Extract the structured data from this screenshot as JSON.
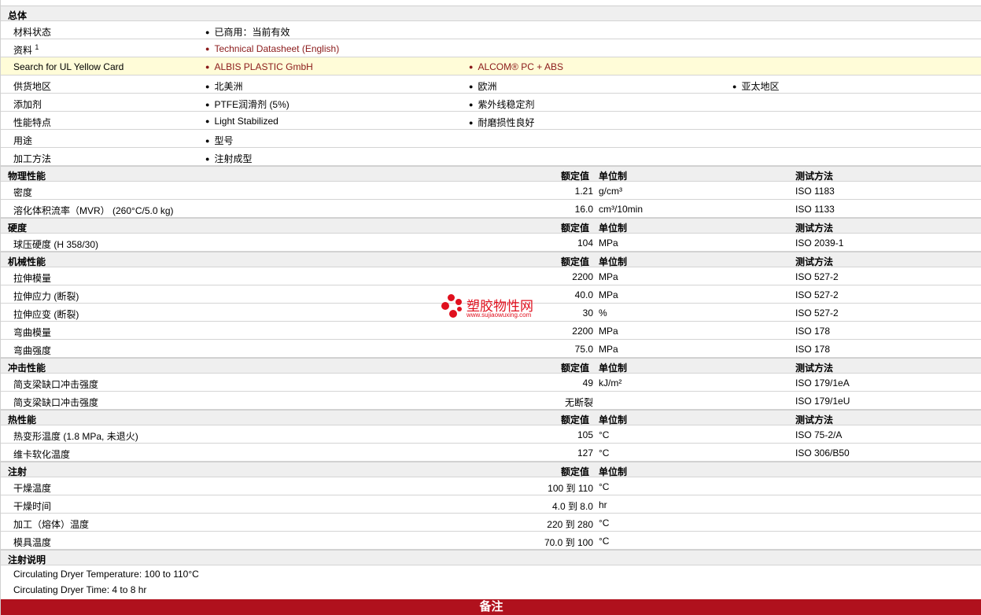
{
  "general": {
    "title": "总体",
    "rows": [
      {
        "label": "材料状态",
        "items": [
          "已商用：当前有效"
        ]
      },
      {
        "label": "资料",
        "sup": "1",
        "items": [
          "Technical Datasheet (English)"
        ],
        "links": true
      },
      {
        "label": "Search for UL Yellow Card",
        "items": [
          "ALBIS PLASTIC GmbH",
          "ALCOM® PC + ABS"
        ],
        "links": true,
        "highlight": true
      },
      {
        "label": "供货地区",
        "items": [
          "北美洲",
          "欧洲",
          "亚太地区"
        ]
      },
      {
        "label": "添加剂",
        "items": [
          "PTFE润滑剂 (5%)",
          "紫外线稳定剂"
        ]
      },
      {
        "label": "性能特点",
        "items": [
          "Light Stabilized",
          "耐磨损性良好"
        ]
      },
      {
        "label": "用途",
        "items": [
          "型号"
        ]
      },
      {
        "label": "加工方法",
        "items": [
          "注射成型"
        ]
      }
    ]
  },
  "headers": {
    "rated": "额定值",
    "unit": "单位制",
    "method": "测试方法"
  },
  "sections": [
    {
      "title": "物理性能",
      "show_method": true,
      "rows": [
        {
          "label": "密度",
          "value": "1.21",
          "unit": "g/cm³",
          "method": "ISO 1183"
        },
        {
          "label": "溶化体积流率（MVR） (260°C/5.0 kg)",
          "value": "16.0",
          "unit": "cm³/10min",
          "method": "ISO 1133"
        }
      ]
    },
    {
      "title": "硬度",
      "show_method": true,
      "rows": [
        {
          "label": "球压硬度 (H 358/30)",
          "value": "104",
          "unit": "MPa",
          "method": "ISO 2039-1"
        }
      ]
    },
    {
      "title": "机械性能",
      "show_method": true,
      "rows": [
        {
          "label": "拉伸模量",
          "value": "2200",
          "unit": "MPa",
          "method": "ISO 527-2"
        },
        {
          "label": "拉伸应力 (断裂)",
          "value": "40.0",
          "unit": "MPa",
          "method": "ISO 527-2"
        },
        {
          "label": "拉伸应变 (断裂)",
          "value": "30",
          "unit": "%",
          "method": "ISO 527-2"
        },
        {
          "label": "弯曲模量",
          "value": "2200",
          "unit": "MPa",
          "method": "ISO 178"
        },
        {
          "label": "弯曲强度",
          "value": "75.0",
          "unit": "MPa",
          "method": "ISO 178"
        }
      ]
    },
    {
      "title": "冲击性能",
      "show_method": true,
      "rows": [
        {
          "label": "简支梁缺口冲击强度",
          "value": "49",
          "unit": "kJ/m²",
          "method": "ISO 179/1eA"
        },
        {
          "label": "简支梁缺口冲击强度",
          "value": "无断裂",
          "unit": "",
          "method": "ISO 179/1eU"
        }
      ]
    },
    {
      "title": "热性能",
      "show_method": true,
      "rows": [
        {
          "label": "热变形温度 (1.8 MPa, 未退火)",
          "value": "105",
          "unit": "°C",
          "method": "ISO 75-2/A"
        },
        {
          "label": "维卡软化温度",
          "value": "127",
          "unit": "°C",
          "method": "ISO 306/B50"
        }
      ]
    },
    {
      "title": "注射",
      "show_method": false,
      "rows": [
        {
          "label": "干燥温度",
          "value": "100 到  110",
          "unit": "°C",
          "method": ""
        },
        {
          "label": "干燥时间",
          "value": "4.0 到  8.0",
          "unit": "hr",
          "method": ""
        },
        {
          "label": "加工（熔体）温度",
          "value": "220 到  280",
          "unit": "°C",
          "method": ""
        },
        {
          "label": "模具温度",
          "value": "70.0 到  100",
          "unit": "°C",
          "method": ""
        }
      ]
    }
  ],
  "notes": {
    "title": "注射说明",
    "lines": [
      "Circulating Dryer Temperature: 100 to 110°C",
      "Circulating Dryer Time: 4 to 8 hr"
    ]
  },
  "watermark": {
    "text": "塑胶物性网",
    "url": "www.sujiaowuxing.com"
  },
  "footer": {
    "label": "备注"
  },
  "colors": {
    "link": "#8b1a1a",
    "footer": "#b0111d",
    "highlight": "#fffcd8",
    "section_bg": "#efefef"
  }
}
